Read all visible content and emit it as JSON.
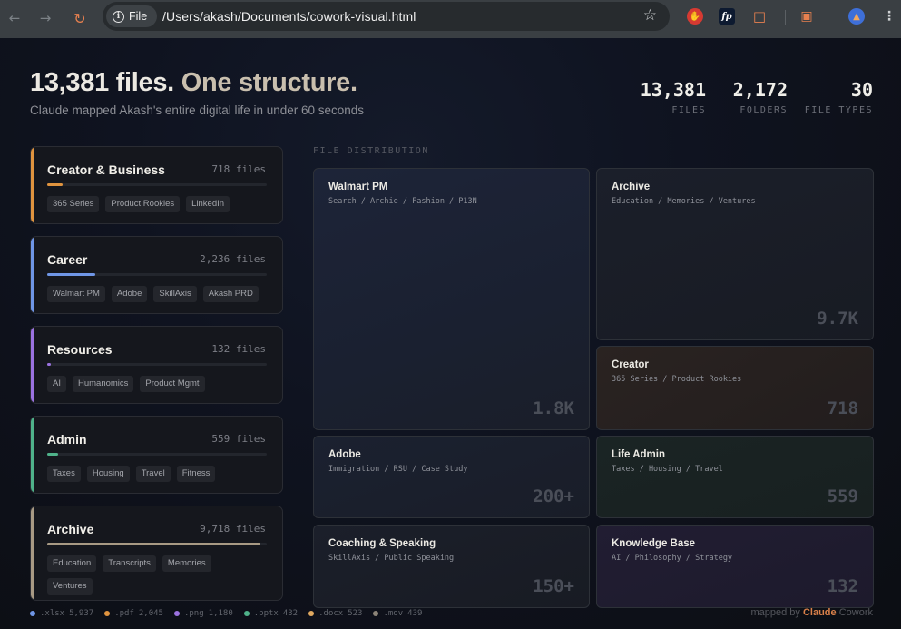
{
  "browser": {
    "site_chip": "File",
    "url": "/Users/akash/Documents/cowork-visual.html"
  },
  "hero": {
    "title_a": "13,381 files.",
    "title_b": "One structure.",
    "subtitle": "Claude mapped Akash's entire digital life in under 60 seconds"
  },
  "stats": [
    {
      "value": "13,381",
      "label": "FILES"
    },
    {
      "value": "2,172",
      "label": "FOLDERS"
    },
    {
      "value": "30",
      "label": "FILE TYPES"
    }
  ],
  "categories": [
    {
      "name": "Creator & Business",
      "count": "718 files",
      "fill_fraction": 0.07,
      "color": "#e0943f",
      "tags": [
        "365 Series",
        "Product Rookies",
        "LinkedIn"
      ]
    },
    {
      "name": "Career",
      "count": "2,236 files",
      "fill_fraction": 0.22,
      "color": "#6f96e6",
      "tags": [
        "Walmart PM",
        "Adobe",
        "SkillAxis",
        "Akash PRD"
      ]
    },
    {
      "name": "Resources",
      "count": "132 files",
      "fill_fraction": 0.01,
      "color": "#9b72e0",
      "tags": [
        "AI",
        "Humanomics",
        "Product Mgmt"
      ]
    },
    {
      "name": "Admin",
      "count": "559 files",
      "fill_fraction": 0.05,
      "color": "#4fb28a",
      "tags": [
        "Taxes",
        "Housing",
        "Travel",
        "Fitness"
      ]
    },
    {
      "name": "Archive",
      "count": "9,718 files",
      "fill_fraction": 0.97,
      "color": "#a89a84",
      "tags": [
        "Education",
        "Transcripts",
        "Memories",
        "Ventures"
      ]
    }
  ],
  "distribution": {
    "label": "FILE DISTRIBUTION",
    "tiles": [
      {
        "name": "Walmart PM",
        "sub": "Search / Archie / Fashion / P13N",
        "value": "1.8K"
      },
      {
        "name": "Archive",
        "sub": "Education / Memories / Ventures",
        "value": "9.7K"
      },
      {
        "name": "Creator",
        "sub": "365 Series / Product Rookies",
        "value": "718"
      },
      {
        "name": "Adobe",
        "sub": "Immigration / RSU / Case Study",
        "value": "200+"
      },
      {
        "name": "Life Admin",
        "sub": "Taxes / Housing / Travel",
        "value": "559"
      },
      {
        "name": "Coaching & Speaking",
        "sub": "SkillAxis / Public Speaking",
        "value": "150+"
      },
      {
        "name": "Knowledge Base",
        "sub": "AI / Philosophy / Strategy",
        "value": "132"
      }
    ]
  },
  "legend": [
    {
      "ext": ".xlsx",
      "count": "5,937",
      "color": "#6f96e6"
    },
    {
      "ext": ".pdf",
      "count": "2,045",
      "color": "#e0943f"
    },
    {
      "ext": ".png",
      "count": "1,180",
      "color": "#9b72e0"
    },
    {
      "ext": ".pptx",
      "count": "432",
      "color": "#4fb28a"
    },
    {
      "ext": ".docx",
      "count": "523",
      "color": "#e0a860"
    },
    {
      "ext": ".mov",
      "count": "439",
      "color": "#8c8478"
    }
  ],
  "credit": {
    "prefix": "mapped by",
    "brand": "Claude",
    "suffix": "Cowork"
  }
}
